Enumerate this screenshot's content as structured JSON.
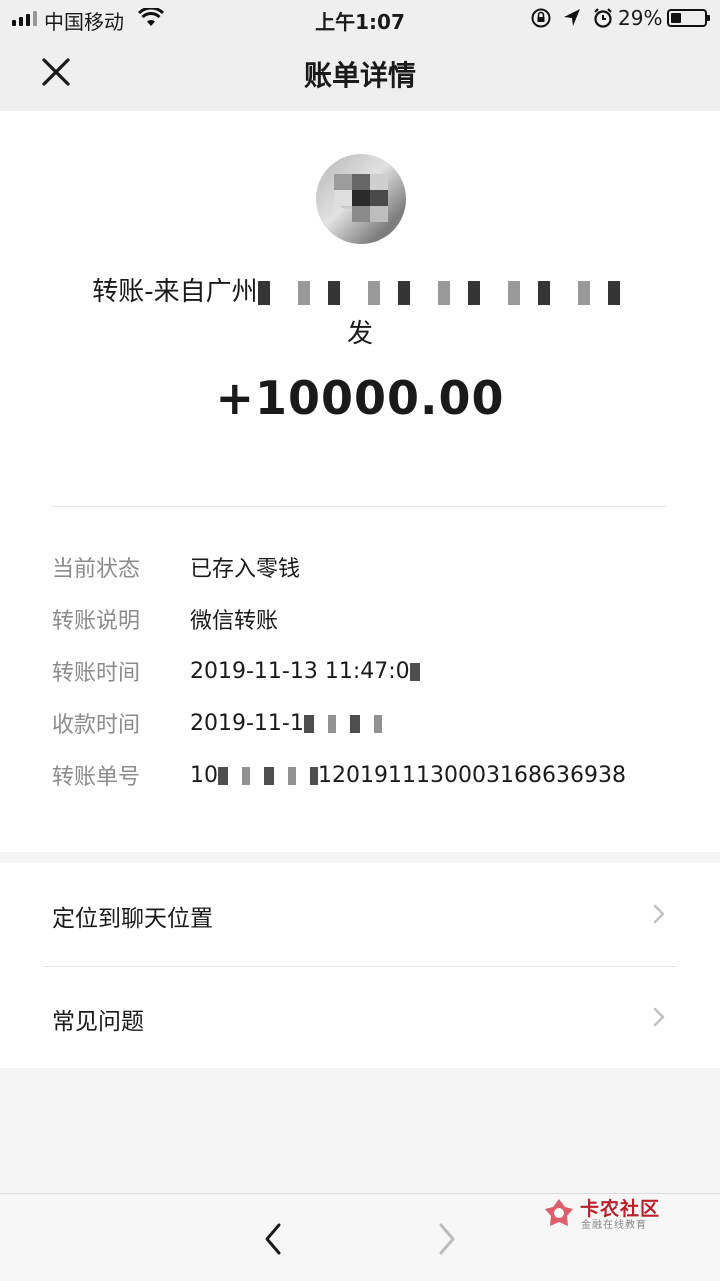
{
  "status_bar": {
    "carrier": "中国移动",
    "time": "上午1:07",
    "battery": "29%"
  },
  "nav": {
    "title": "账单详情",
    "close_icon": "close-icon"
  },
  "bill": {
    "from_prefix": "转账-来自广州",
    "from_suffix": "发",
    "amount": "+10000.00"
  },
  "details": [
    {
      "label": "当前状态",
      "value": "已存入零钱"
    },
    {
      "label": "转账说明",
      "value": "微信转账"
    },
    {
      "label": "转账时间",
      "value": "2019-11-13 11:47:0"
    },
    {
      "label": "收款时间",
      "value": "2019-11-1"
    },
    {
      "label": "转账单号",
      "value_prefix": "10",
      "value": "1201911130003168636938"
    }
  ],
  "links": [
    {
      "label": "定位到聊天位置",
      "icon": "chevron-right-icon"
    },
    {
      "label": "常见问题",
      "icon": "chevron-right-icon"
    }
  ],
  "toolbar": {
    "back_icon": "chevron-left-icon",
    "forward_icon": "chevron-right-icon"
  },
  "watermark": {
    "title": "卡农社区",
    "subtitle": "金融在线教育"
  },
  "colors": {
    "watermark_red": "#b91f2c",
    "label_gray": "#8c8c8c",
    "background": "#f5f5f5"
  }
}
